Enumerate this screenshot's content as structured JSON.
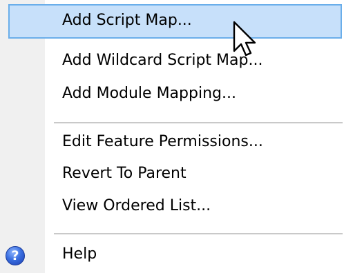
{
  "menu": {
    "items": [
      {
        "label": "Add Script Map..."
      },
      {
        "label": "Add Wildcard Script Map..."
      },
      {
        "label": "Add Module Mapping..."
      },
      {
        "label": "Edit Feature Permissions..."
      },
      {
        "label": "Revert To Parent"
      },
      {
        "label": "View Ordered List..."
      },
      {
        "label": "Help"
      }
    ],
    "highlighted_item": "Add Script Map...",
    "help_icon_glyph": "?"
  },
  "colors": {
    "highlight_fill": "#c7e0fa",
    "highlight_border": "#6aaeea",
    "help_icon_blue": "#3a6fe0"
  }
}
